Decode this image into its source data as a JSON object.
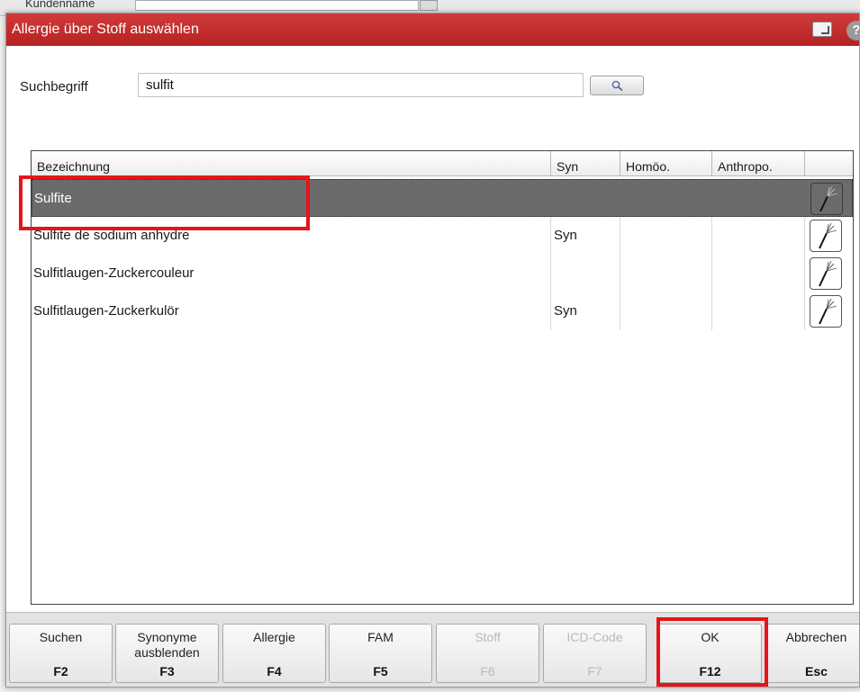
{
  "background": {
    "label": "Kundenname"
  },
  "dialog": {
    "title": "Allergie über Stoff auswählen",
    "help": "?"
  },
  "search": {
    "label": "Suchbegriff",
    "value": "sulfit"
  },
  "table": {
    "columns": [
      "Bezeichnung",
      "Syn",
      "Homöo.",
      "Anthropo.",
      ""
    ],
    "rows": [
      {
        "name": "Sulfite",
        "syn": "",
        "homoeo": "",
        "anthropo": "",
        "selected": true
      },
      {
        "name": "Sulfite de sodium anhydre",
        "syn": "Syn",
        "homoeo": "",
        "anthropo": "",
        "selected": false
      },
      {
        "name": "Sulfitlaugen-Zuckercouleur",
        "syn": "",
        "homoeo": "",
        "anthropo": "",
        "selected": false
      },
      {
        "name": "Sulfitlaugen-Zuckerkulör",
        "syn": "Syn",
        "homoeo": "",
        "anthropo": "",
        "selected": false
      }
    ]
  },
  "function_keys": [
    {
      "label": "Suchen",
      "key": "F2",
      "enabled": true
    },
    {
      "label": "Synonyme ausblenden",
      "key": "F3",
      "enabled": true
    },
    {
      "label": "Allergie",
      "key": "F4",
      "enabled": true
    },
    {
      "label": "FAM",
      "key": "F5",
      "enabled": true
    },
    {
      "label": "Stoff",
      "key": "F6",
      "enabled": false
    },
    {
      "label": "ICD-Code",
      "key": "F7",
      "enabled": false
    },
    {
      "label": "OK",
      "key": "F12",
      "enabled": true
    },
    {
      "label": "Abbrechen",
      "key": "Esc",
      "enabled": true
    }
  ],
  "colors": {
    "title_bar": "#c62d2d",
    "selection": "#6b6b6b",
    "highlight": "#e3161b"
  }
}
